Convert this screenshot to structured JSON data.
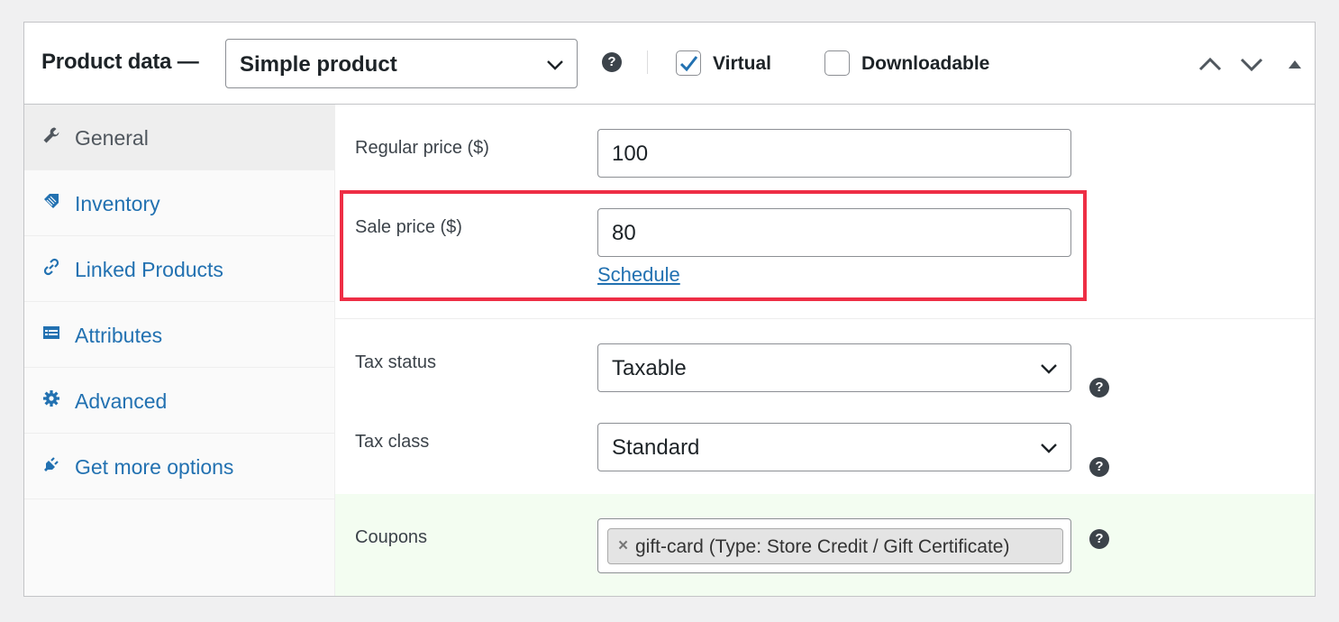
{
  "header": {
    "title": "Product data —",
    "product_type": {
      "value": "Simple product"
    },
    "virtual": {
      "label": "Virtual",
      "checked": true
    },
    "downloadable": {
      "label": "Downloadable",
      "checked": false
    }
  },
  "nav": {
    "items": [
      {
        "label": "General",
        "icon": "wrench-icon",
        "active": true
      },
      {
        "label": "Inventory",
        "icon": "tag-icon",
        "active": false
      },
      {
        "label": "Linked Products",
        "icon": "link-icon",
        "active": false
      },
      {
        "label": "Attributes",
        "icon": "list-table-icon",
        "active": false
      },
      {
        "label": "Advanced",
        "icon": "gear-icon",
        "active": false
      },
      {
        "label": "Get more options",
        "icon": "plugin-icon",
        "active": false
      }
    ]
  },
  "general": {
    "regular_price": {
      "label": "Regular price ($)",
      "value": "100"
    },
    "sale_price": {
      "label": "Sale price ($)",
      "value": "80",
      "schedule_link": "Schedule"
    },
    "tax_status": {
      "label": "Tax status",
      "value": "Taxable"
    },
    "tax_class": {
      "label": "Tax class",
      "value": "Standard"
    },
    "coupons": {
      "label": "Coupons",
      "tags": [
        "gift-card (Type: Store Credit / Gift Certificate)"
      ],
      "remove_glyph": "×"
    }
  },
  "colors": {
    "link": "#2271b1",
    "highlight_border": "#ee2e45",
    "coupons_background": "#f3fdf1",
    "checkbox_check": "#2271b1"
  }
}
